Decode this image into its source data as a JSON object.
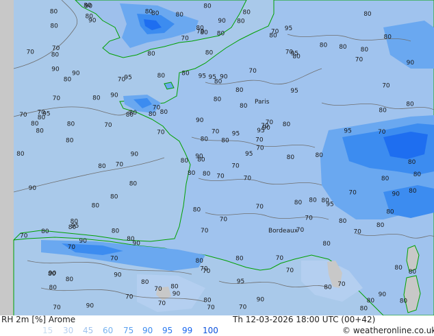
{
  "header": {
    "product": "RH 2m [%] Arome",
    "datetime": "Th 12-03-2026 18:00 UTC (00+42)",
    "copyright": "© weatheronline.co.uk"
  },
  "legend": {
    "items": [
      {
        "label": "15",
        "color": "#c8dcf0"
      },
      {
        "label": "30",
        "color": "#b4cff0"
      },
      {
        "label": "45",
        "color": "#a0c3ee"
      },
      {
        "label": "60",
        "color": "#78b4f0"
      },
      {
        "label": "75",
        "color": "#5aa0f0"
      },
      {
        "label": "90",
        "color": "#3c8cf0"
      },
      {
        "label": "95",
        "color": "#2878f0"
      },
      {
        "label": "99",
        "color": "#1464f0"
      },
      {
        "label": "100",
        "color": "#0a50dc"
      }
    ]
  },
  "map": {
    "places": [
      {
        "name": "Paris"
      },
      {
        "name": "Bordeaux"
      }
    ],
    "contour_labels": [
      "70",
      "80",
      "80",
      "90",
      "95",
      "90",
      "95",
      "90",
      "95",
      "95",
      "90",
      "80",
      "80",
      "90",
      "80",
      "95",
      "90",
      "95",
      "80",
      "90",
      "80",
      "80",
      "90",
      "95",
      "90",
      "95",
      "90",
      "80",
      "80",
      "80",
      "80",
      "90",
      "80",
      "80",
      "95",
      "80",
      "80",
      "80",
      "80",
      "80",
      "80",
      "80",
      "70",
      "70",
      "70",
      "70",
      "70",
      "70",
      "70",
      "70",
      "70",
      "70",
      "70",
      "70",
      "70",
      "70",
      "80",
      "80",
      "80",
      "80",
      "90",
      "90",
      "95",
      "90",
      "80",
      "80",
      "70",
      "70",
      "70",
      "70",
      "70",
      "70",
      "80",
      "80",
      "80",
      "80",
      "80",
      "90",
      "90",
      "95",
      "95",
      "80",
      "80",
      "80",
      "80",
      "70",
      "70",
      "70",
      "70",
      "70",
      "80",
      "80",
      "80",
      "80",
      "80",
      "80",
      "80",
      "70",
      "70",
      "80",
      "80",
      "80",
      "80",
      "80",
      "80",
      "80",
      "80",
      "70",
      "70",
      "70",
      "80",
      "80",
      "80",
      "80",
      "80",
      "80",
      "80",
      "80",
      "80",
      "80",
      "80",
      "80",
      "80",
      "80",
      "80",
      "80",
      "90",
      "90",
      "95",
      "90",
      "95",
      "90",
      "80",
      "80",
      "90",
      "80",
      "80",
      "80",
      "80",
      "70",
      "70",
      "80",
      "70",
      "70",
      "70",
      "70",
      "80",
      "80",
      "70",
      "70",
      "80",
      "70",
      "70",
      "70",
      "70",
      "80",
      "80",
      "80",
      "70",
      "70",
      "70",
      "80",
      "80",
      "80",
      "80",
      "70",
      "80",
      "80",
      "90",
      "80"
    ],
    "colors": {
      "sea": "#a9c9ea",
      "land": "#a0c3ee",
      "humid": "#78b4f0",
      "very_humid": "#3c8cf0",
      "saturated": "#1464f0",
      "coast": "#00a000",
      "contour": "#6e6e6e",
      "outside_domain": "#c8c8c8"
    }
  }
}
